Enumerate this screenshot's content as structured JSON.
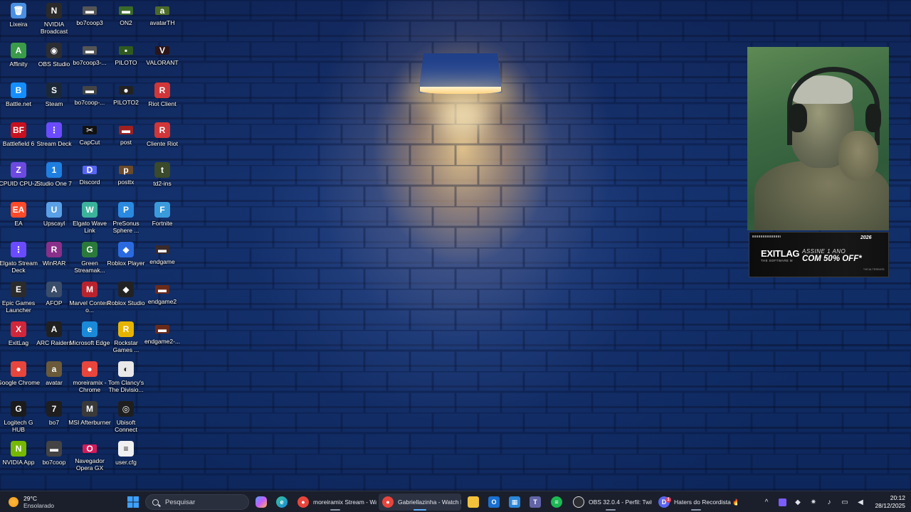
{
  "desktop": {
    "icons": [
      {
        "label": "Lixeira",
        "icon": "recycle-bin-icon",
        "color": "#4a8fe0",
        "glyph": "🗑"
      },
      {
        "label": "Affinity",
        "icon": "affinity-icon",
        "color": "#3a9b48",
        "glyph": "A"
      },
      {
        "label": "Battle.net",
        "icon": "battlenet-icon",
        "color": "#148eff",
        "glyph": "B"
      },
      {
        "label": "Battlefield 6",
        "icon": "battlefield-icon",
        "color": "#c8101f",
        "glyph": "BF"
      },
      {
        "label": "CPUID CPU-Z",
        "icon": "cpuz-icon",
        "color": "#6c4ae0",
        "glyph": "Z"
      },
      {
        "label": "EA",
        "icon": "ea-icon",
        "color": "#ff4a2a",
        "glyph": "EA"
      },
      {
        "label": "Elgato Stream Deck",
        "icon": "elgato-stream-deck-icon",
        "color": "#6b4bff",
        "glyph": "⋮"
      },
      {
        "label": "Epic Games Launcher",
        "icon": "epic-games-icon",
        "color": "#2b2b2b",
        "glyph": "E"
      },
      {
        "label": "ExitLag",
        "icon": "exitlag-icon",
        "color": "#d2263a",
        "glyph": "X"
      },
      {
        "label": "Google Chrome",
        "icon": "chrome-icon",
        "color": "#e8453c",
        "glyph": "●"
      },
      {
        "label": "Logitech G HUB",
        "icon": "logitech-icon",
        "color": "#1b1b1b",
        "glyph": "G"
      },
      {
        "label": "NVIDIA App",
        "icon": "nvidia-app-icon",
        "color": "#76b900",
        "glyph": "N"
      },
      {
        "label": "NVIDIA Broadcast",
        "icon": "nvidia-broadcast-icon",
        "color": "#2a2a2a",
        "glyph": "N"
      },
      {
        "label": "OBS Studio",
        "icon": "obs-icon",
        "color": "#2b2d33",
        "glyph": "◉"
      },
      {
        "label": "Steam",
        "icon": "steam-icon",
        "color": "#1b2838",
        "glyph": "S"
      },
      {
        "label": "Stream Deck",
        "icon": "stream-deck-icon",
        "color": "#6b4bff",
        "glyph": "⋮"
      },
      {
        "label": "Studio One 7",
        "icon": "studio-one-icon",
        "color": "#1f7fe0",
        "glyph": "1"
      },
      {
        "label": "Upscayl",
        "icon": "upscayl-icon",
        "color": "#5aa0e6",
        "glyph": "U"
      },
      {
        "label": "WinRAR",
        "icon": "winrar-icon",
        "color": "#8a2f8a",
        "glyph": "R"
      },
      {
        "label": "AFOP",
        "icon": "afop-icon",
        "color": "#3a4d6a",
        "glyph": "A"
      },
      {
        "label": "ARC Raiders",
        "icon": "arc-raiders-icon",
        "color": "#202020",
        "glyph": "A"
      },
      {
        "label": "avatar",
        "icon": "avatar-game-icon",
        "color": "#6a5a3a",
        "glyph": "a"
      },
      {
        "label": "bo7",
        "icon": "bo7-icon",
        "color": "#1e1e1e",
        "glyph": "7"
      },
      {
        "label": "bo7coop",
        "icon": "bo7coop-icon",
        "color": "#444",
        "glyph": "▬"
      },
      {
        "label": "bo7coop3",
        "icon": "bo7coop3-icon",
        "color": "#555",
        "glyph": "▬"
      },
      {
        "label": "bo7coop3-...",
        "icon": "bo7coop3-shortcut-icon",
        "color": "#555",
        "glyph": "▬"
      },
      {
        "label": "bo7coop-...",
        "icon": "bo7coop-shortcut-icon",
        "color": "#444",
        "glyph": "▬"
      },
      {
        "label": "CapCut",
        "icon": "capcut-icon",
        "color": "#111",
        "glyph": "✂"
      },
      {
        "label": "Discord",
        "icon": "discord-icon",
        "color": "#5865f2",
        "glyph": "D"
      },
      {
        "label": "Elgato Wave Link",
        "icon": "wave-link-icon",
        "color": "#3bb39b",
        "glyph": "W"
      },
      {
        "label": "Green Streamak...",
        "icon": "green-streamak-icon",
        "color": "#2b7a3a",
        "glyph": "G"
      },
      {
        "label": "Marvel Contest o...",
        "icon": "marvel-contest-icon",
        "color": "#b8232e",
        "glyph": "M"
      },
      {
        "label": "Microsoft Edge",
        "icon": "edge-icon",
        "color": "#1a8ad8",
        "glyph": "e"
      },
      {
        "label": "moreiramix - Chrome",
        "icon": "chrome-profile-icon",
        "color": "#e8453c",
        "glyph": "●"
      },
      {
        "label": "MSI Afterburner",
        "icon": "msi-afterburner-icon",
        "color": "#3a3a3a",
        "glyph": "M"
      },
      {
        "label": "Navegador Opera GX",
        "icon": "opera-gx-icon",
        "color": "#d41a5a",
        "glyph": "O"
      },
      {
        "label": "ON2",
        "icon": "on2-icon",
        "color": "#3a6a2a",
        "glyph": "▬"
      },
      {
        "label": "PILOTO",
        "icon": "piloto-icon",
        "color": "#2f5a1f",
        "glyph": "▪"
      },
      {
        "label": "PILOTO2",
        "icon": "piloto2-icon",
        "color": "#222",
        "glyph": "●"
      },
      {
        "label": "post",
        "icon": "post-icon",
        "color": "#a02020",
        "glyph": "▬"
      },
      {
        "label": "posttx",
        "icon": "posttx-icon",
        "color": "#6a4a2a",
        "glyph": "p"
      },
      {
        "label": "PreSonus Sphere ...",
        "icon": "presonus-icon",
        "color": "#2a8ae0",
        "glyph": "P"
      },
      {
        "label": "Roblox Player",
        "icon": "roblox-player-icon",
        "color": "#2a6ae0",
        "glyph": "◆"
      },
      {
        "label": "Roblox Studio",
        "icon": "roblox-studio-icon",
        "color": "#222",
        "glyph": "◆"
      },
      {
        "label": "Rockstar Games ...",
        "icon": "rockstar-icon",
        "color": "#e6b400",
        "glyph": "R"
      },
      {
        "label": "Tom Clancy's The Divisio...",
        "icon": "division-icon",
        "color": "#e8e8e8",
        "glyph": "◐"
      },
      {
        "label": "Ubisoft Connect",
        "icon": "ubisoft-icon",
        "color": "#1e1e1e",
        "glyph": "◎"
      },
      {
        "label": "user.cfg",
        "icon": "cfg-file-icon",
        "color": "#f0f0f0",
        "glyph": "≡"
      },
      {
        "label": "avatarTH",
        "icon": "avatarth-icon",
        "color": "#4a6a2a",
        "glyph": "a"
      },
      {
        "label": "VALORANT",
        "icon": "valorant-icon",
        "color": "#2a1418",
        "glyph": "V"
      },
      {
        "label": "Riot Client",
        "icon": "riot-client-icon",
        "color": "#d13639",
        "glyph": "R"
      },
      {
        "label": "Cliente Riot",
        "icon": "cliente-riot-icon",
        "color": "#d13639",
        "glyph": "R"
      },
      {
        "label": "td2-ins",
        "icon": "td2-ins-icon",
        "color": "#3a4a2a",
        "glyph": "t"
      },
      {
        "label": "Fortnite",
        "icon": "fortnite-icon",
        "color": "#3a9bdc",
        "glyph": "F"
      },
      {
        "label": "endgame",
        "icon": "endgame-icon",
        "color": "#3a2a2a",
        "glyph": "▬"
      },
      {
        "label": "endgame2",
        "icon": "endgame2-icon",
        "color": "#6a2a1a",
        "glyph": "▬"
      },
      {
        "label": "endgame2-...",
        "icon": "endgame2-shortcut-icon",
        "color": "#6a2a1a",
        "glyph": "▬"
      }
    ]
  },
  "ad": {
    "brand": "EXITLAG",
    "brand_sub": "THE SOFTWARE M",
    "offer_top": "ASSINE 1 ANO",
    "offer": "COM 50% OFF*",
    "year": "2026",
    "note": "*VEJA TERMOS"
  },
  "taskbar": {
    "weather": {
      "temp": "29°C",
      "condition": "Ensolarado"
    },
    "search": {
      "placeholder": "Pesquisar"
    },
    "windows": [
      {
        "label": "moreiramix Stream - Wa",
        "icon": "chrome-icon",
        "color": "#e8453c",
        "glyph": "●"
      },
      {
        "label": "Gabriellazinha - Watch l",
        "icon": "chrome-icon",
        "color": "#e8453c",
        "glyph": "●"
      },
      {
        "label": "OBS 32.0.4 - Perfil: Twitc",
        "icon": "obs-icon",
        "color": "#2b2d33",
        "glyph": "◉"
      },
      {
        "label": "Haters do Recordista 🔥",
        "icon": "discord-icon",
        "color": "#5865f2",
        "glyph": "D",
        "badge": "1"
      }
    ],
    "clock": {
      "time": "20:12",
      "date": "28/12/2025"
    }
  }
}
